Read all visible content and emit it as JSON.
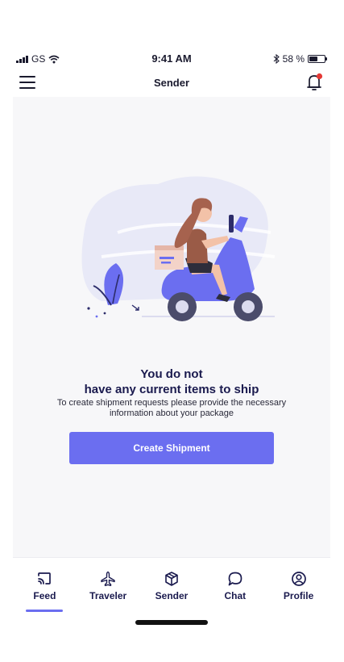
{
  "status_bar": {
    "carrier": "GS",
    "time": "9:41 AM",
    "bluetooth_icon": "bluetooth-icon",
    "battery_text": "58 %",
    "battery_level": 0.58
  },
  "header": {
    "title": "Sender",
    "menu_icon": "hamburger-menu-icon",
    "notification_icon": "bell-icon",
    "notification_badge_color": "#e53935"
  },
  "empty_state": {
    "illustration": "woman-on-scooter-with-package",
    "title_line1": "You do not",
    "title_line2": "have any current items to ship",
    "description": "To create shipment requests please provide the necessary information about your package",
    "cta_label": "Create Shipment"
  },
  "tabs": [
    {
      "label": "Feed",
      "icon": "cast-icon",
      "active": true
    },
    {
      "label": "Traveler",
      "icon": "airplane-icon",
      "active": false
    },
    {
      "label": "Sender",
      "icon": "package-box-icon",
      "active": false
    },
    {
      "label": "Chat",
      "icon": "chat-bubble-icon",
      "active": false
    },
    {
      "label": "Profile",
      "icon": "user-circle-icon",
      "active": false
    }
  ],
  "colors": {
    "accent": "#6b6ef0",
    "text_dark": "#1a1a4e",
    "background": "#f7f7f9"
  }
}
